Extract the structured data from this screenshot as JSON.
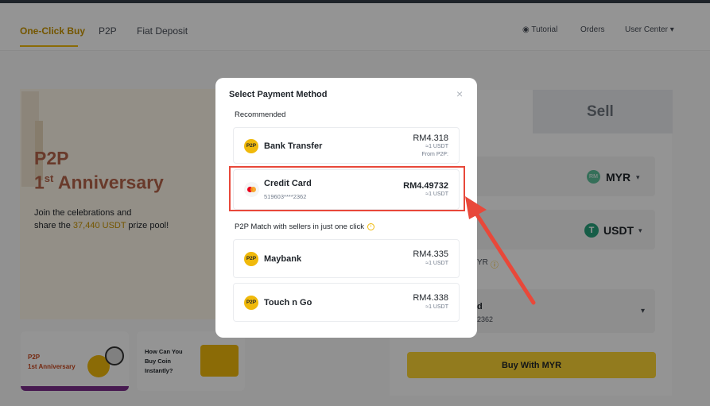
{
  "nav": {
    "tabs": [
      "One-Click Buy",
      "P2P",
      "Fiat Deposit"
    ],
    "tutorial": "Tutorial",
    "orders": "Orders",
    "user_center": "User Center"
  },
  "banner": {
    "title_line1": "P2P",
    "title_line2_prefix": "1",
    "title_line2_sup": "st",
    "title_line2_suffix": " Anniversary",
    "text_line1": "Join the celebrations and",
    "text_line2_prefix": "share the ",
    "text_highlight": "37,440 USDT",
    "text_line2_suffix": " prize pool!"
  },
  "promo_cards": {
    "card1_line1": "P2P",
    "card1_line2": "1st Anniversary",
    "card2_line1": "How Can You",
    "card2_line2": "Buy Coin",
    "card2_line3": "Instantly?"
  },
  "form": {
    "sell_tab": "Sell",
    "spend_currency": "MYR",
    "receive_currency": "USDT",
    "partial_myr": "YR",
    "partial_d": "d",
    "partial_card": "2362",
    "buy_button": "Buy With MYR"
  },
  "modal": {
    "title": "Select Payment Method",
    "close": "×",
    "recommended_label": "Recommended",
    "p2p_match_label": "P2P Match with sellers in just one click",
    "options": [
      {
        "name": "Bank Transfer",
        "price": "RM4.318",
        "rate": "≈1 USDT",
        "source": "From P2P:"
      },
      {
        "name": "Credit Card",
        "sub": "519603****2362",
        "price": "RM4.49732",
        "rate": "≈1 USDT"
      },
      {
        "name": "Maybank",
        "price": "RM4.335",
        "rate": "≈1 USDT"
      },
      {
        "name": "Touch n Go",
        "price": "RM4.338",
        "rate": "≈1 USDT"
      }
    ]
  },
  "colors": {
    "accent": "#f0b90b",
    "annotation": "#e8483a"
  }
}
